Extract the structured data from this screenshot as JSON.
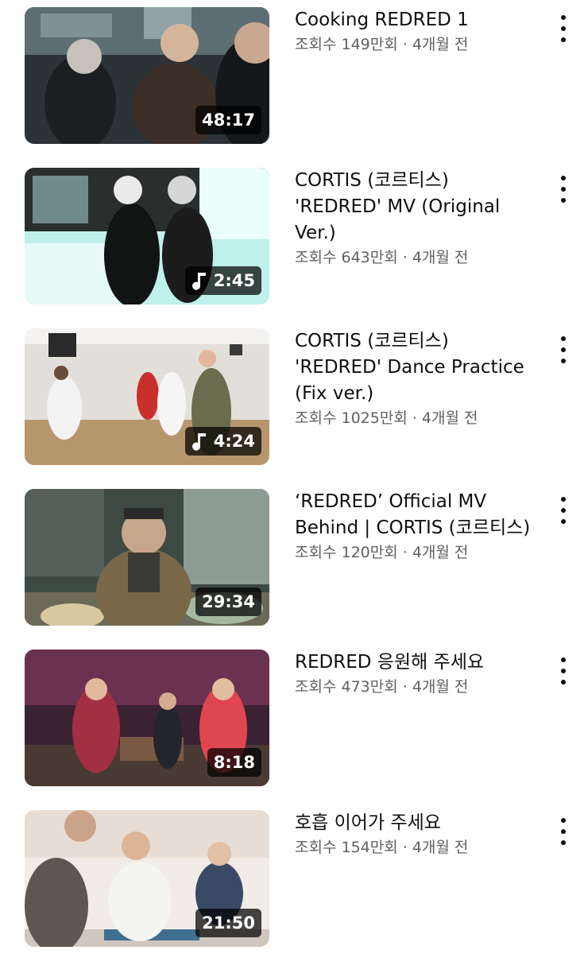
{
  "videos": [
    {
      "title": "Cooking REDRED 1",
      "views": "조회수 149만회",
      "age": "4개월 전",
      "duration": "48:17",
      "music": false,
      "palette": [
        "#3a4a4f",
        "#20262a",
        "#6a7f83"
      ]
    },
    {
      "title": "CORTIS (코르티스)\n'REDRED' MV (Original\nVer.)",
      "views": "조회수 643만회",
      "age": "4개월 전",
      "duration": "2:45",
      "music": true,
      "palette": [
        "#9be6df",
        "#1d1f1f",
        "#d8fbf3"
      ]
    },
    {
      "title": "CORTIS (코르티스)\n'REDRED' Dance Practice\n(Fix ver.)",
      "views": "조회수 1025만회",
      "age": "4개월 전",
      "duration": "4:24",
      "music": true,
      "palette": [
        "#d9d6d0",
        "#b89a74",
        "#efefec"
      ]
    },
    {
      "title": "‘REDRED’ Official MV\nBehind | CORTIS (코르티스)",
      "views": "조회수 120만회",
      "age": "4개월 전",
      "duration": "29:34",
      "music": false,
      "palette": [
        "#4c5246",
        "#7a6a4a",
        "#2c3530"
      ]
    },
    {
      "title": "REDRED 응원해 주세요",
      "views": "조회수 473만회",
      "age": "4개월 전",
      "duration": "8:18",
      "music": false,
      "palette": [
        "#5a2a44",
        "#b13a4b",
        "#2a1f2c"
      ]
    },
    {
      "title": "호흡 이어가 주세요",
      "views": "조회수 154만회",
      "age": "4개월 전",
      "duration": "21:50",
      "music": false,
      "palette": [
        "#f3eee9",
        "#6a5e55",
        "#d8cfc6"
      ]
    }
  ],
  "separator": " · ",
  "icons": {
    "more": "more-vert-icon",
    "music": "music-note-icon"
  }
}
